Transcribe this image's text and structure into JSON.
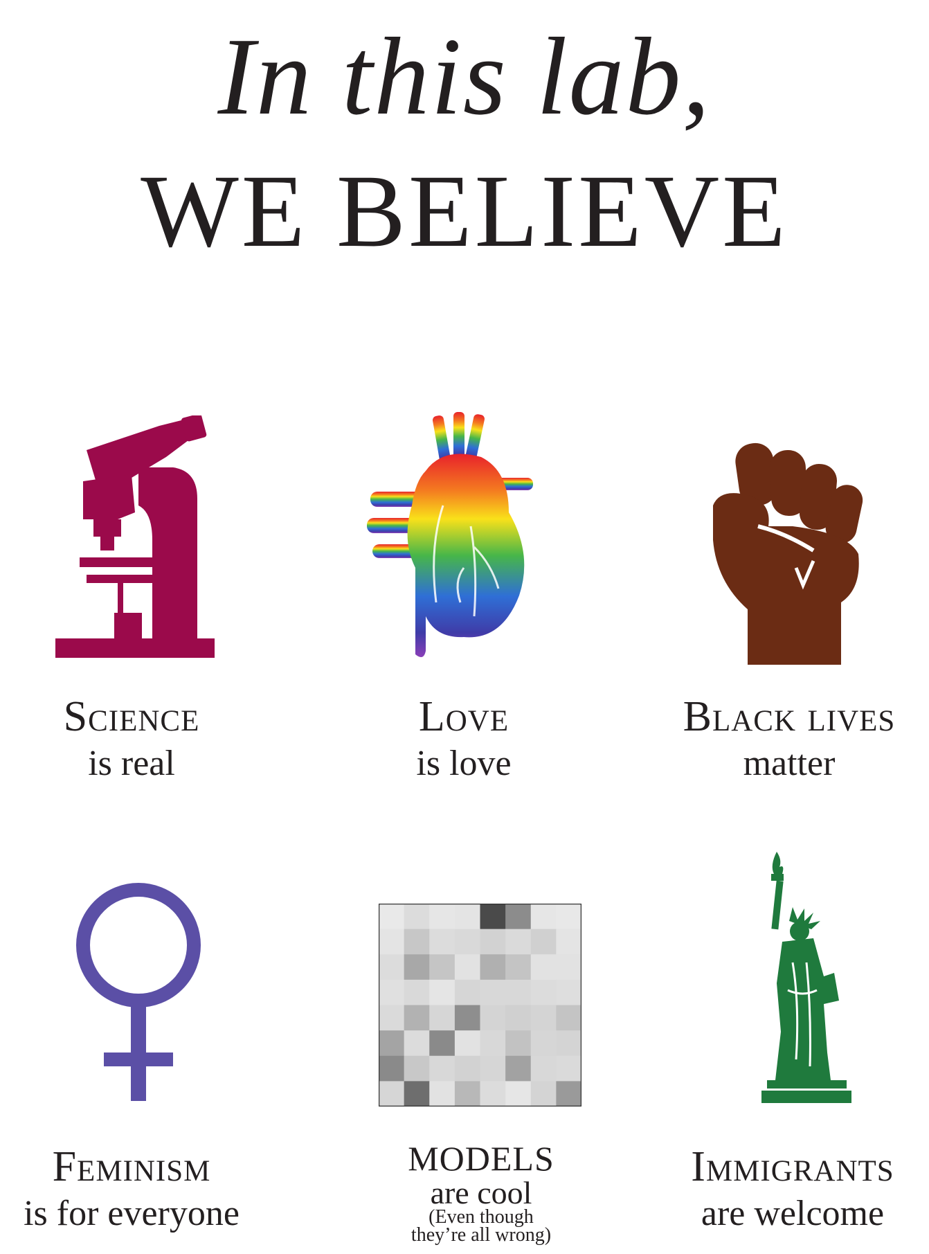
{
  "header": {
    "line1": "In this lab,",
    "line2": "WE BELIEVE"
  },
  "items": [
    {
      "icon": "microscope-icon",
      "color": "#9b0a4b",
      "main": "Science",
      "sub": "is real"
    },
    {
      "icon": "rainbow-heart-icon",
      "color": "rainbow",
      "main": "Love",
      "sub": "is love"
    },
    {
      "icon": "raised-fist-icon",
      "color": "#6b2c14",
      "main": "Black lives",
      "sub": "matter"
    },
    {
      "icon": "venus-symbol-icon",
      "color": "#5b4fa6",
      "main": "Feminism",
      "sub": "is for everyone"
    },
    {
      "icon": "pixelated-image-icon",
      "color": "#9a9a9a",
      "main": "MODELS",
      "sub": "are cool",
      "note1": "(Even though",
      "note2": "they’re all wrong)"
    },
    {
      "icon": "statue-of-liberty-icon",
      "color": "#1f7a3d",
      "main": "Immigrants",
      "sub": "are welcome"
    }
  ]
}
